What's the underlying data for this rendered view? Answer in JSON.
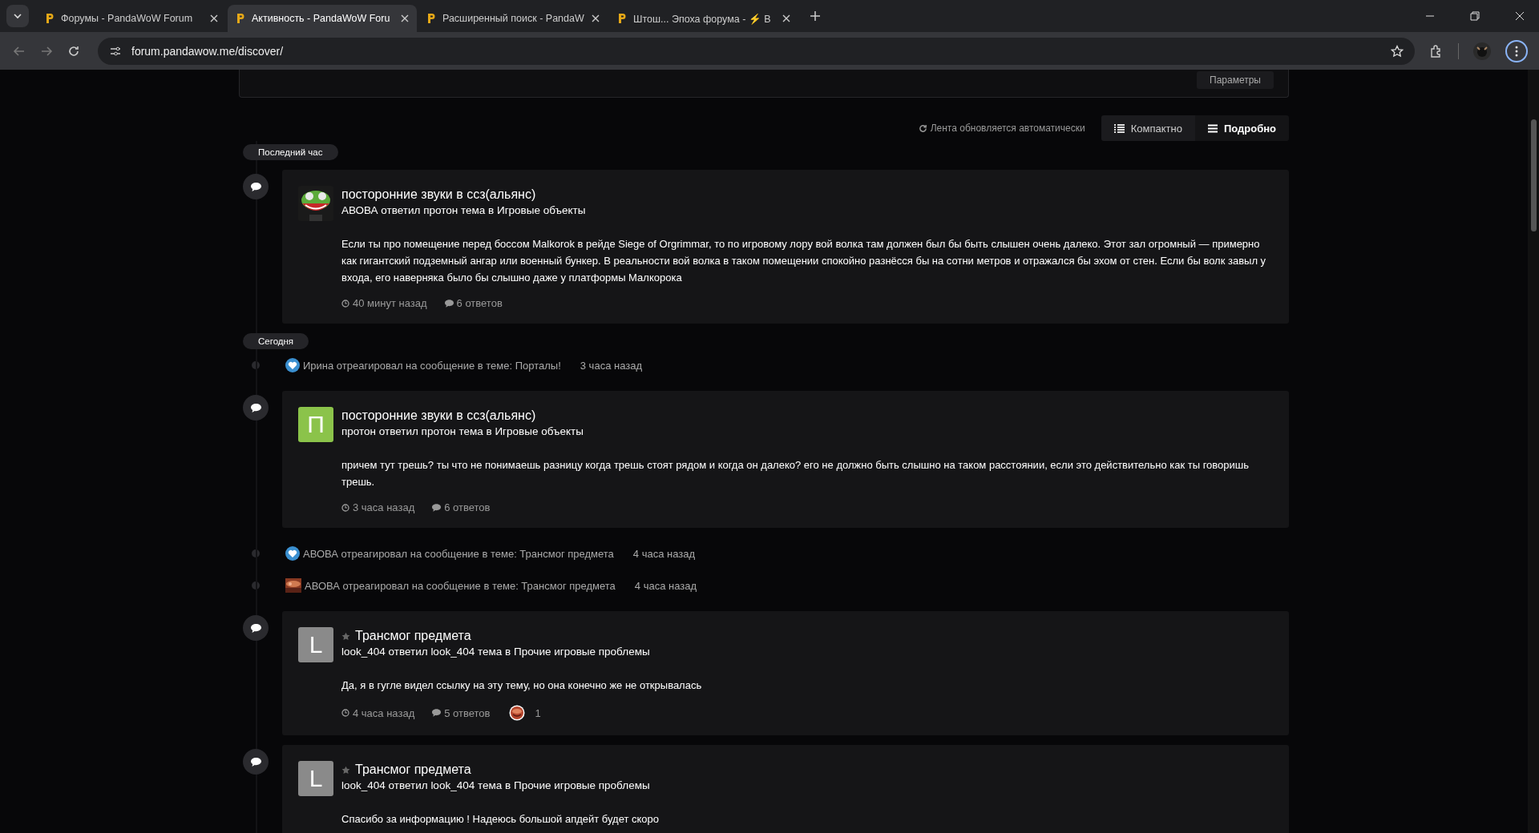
{
  "browser": {
    "tabs": [
      {
        "title": "Форумы - PandaWoW Forum",
        "selected": false
      },
      {
        "title": "Активность - PandaWoW Foru",
        "selected": true
      },
      {
        "title": "Расширенный поиск - PandaW",
        "selected": false
      },
      {
        "title": "Штош... Эпоха форума - ⚡ В",
        "selected": false
      }
    ],
    "url": "forum.pandawow.me/discover/"
  },
  "filter_button": "Параметры",
  "feed_status": "Лента обновляется автоматически",
  "view_modes": [
    {
      "label": "Компактно",
      "selected": false
    },
    {
      "label": "Подробно",
      "selected": true
    }
  ],
  "sections": [
    {
      "label": "Последний час",
      "items": [
        {
          "kind": "post",
          "title": "посторонние звуки в ссз(альянс)",
          "starred": false,
          "byline": "АВОВА ответил протон тема в Игровые объекты",
          "body": "Если ты про помещение перед боссом Malkorok в рейде Siege of Orgrimmar, то по игровому лору вой волка там должен был бы быть слышен очень далеко. Этот зал огромный — примерно как гигантский подземный ангар или военный бункер. В реальности вой волка в таком помещении спокойно разнёсся бы на сотни метров и отражался бы эхом от стен. Если бы волк завыл у входа, его наверняка было бы слышно даже у платформы Малкорока",
          "time": "40 минут назад",
          "replies": "6 ответов"
        }
      ]
    },
    {
      "label": "Сегодня",
      "items": [
        {
          "kind": "like",
          "text": "Ирина отреагировал на сообщение в теме: Порталы!",
          "time": "3 часа назад"
        },
        {
          "kind": "post",
          "letter": "П",
          "color": "#8bc34a",
          "title": "посторонние звуки в ссз(альянс)",
          "starred": false,
          "byline": "протон ответил протон тема в Игровые объекты",
          "body": "причем тут трешь? ты что не понимаешь разницу когда трешь стоят рядом и когда он далеко? его не должно быть слышно на таком расстоянии, если это действительно как ты говоришь трешь.",
          "time": "3 часа назад",
          "replies": "6 ответов"
        },
        {
          "kind": "like",
          "text": "АВОВА отреагировал на сообщение в теме: Трансмог предмета",
          "time": "4 часа назад"
        },
        {
          "kind": "reaction",
          "text": "АВОВА отреагировал на сообщение в теме: Трансмог предмета",
          "time": "4 часа назад"
        },
        {
          "kind": "post",
          "letter": "L",
          "color": "#8a8a8a",
          "title": "Трансмог предмета",
          "starred": true,
          "byline": "look_404 ответил look_404 тема в Прочие игровые проблемы",
          "body": "Да, я в гугле видел ссылку на эту тему, но она конечно же не открывалась",
          "time": "4 часа назад",
          "replies": "5 ответов",
          "reactions": "1"
        },
        {
          "kind": "post",
          "letter": "L",
          "color": "#8a8a8a",
          "title": "Трансмог предмета",
          "starred": true,
          "byline": "look_404 ответил look_404 тема в Прочие игровые проблемы",
          "body": "Спасибо за информацию ! Надеюсь большой апдейт будет скоро"
        }
      ]
    }
  ]
}
